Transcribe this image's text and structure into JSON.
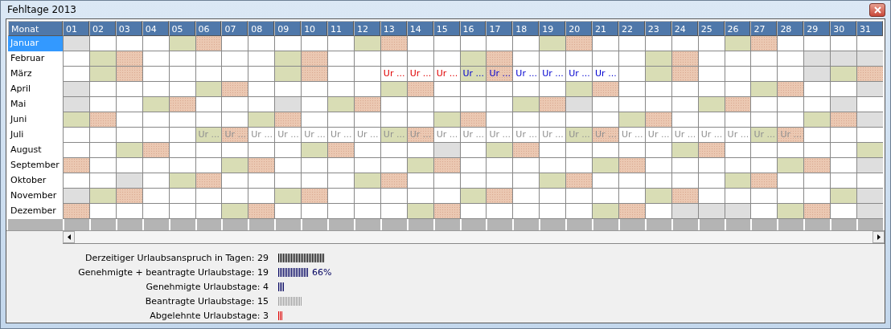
{
  "window": {
    "title": "Fehltage 2013"
  },
  "grid": {
    "corner": "Monat",
    "days": [
      "01",
      "02",
      "03",
      "04",
      "05",
      "06",
      "07",
      "08",
      "09",
      "10",
      "11",
      "12",
      "13",
      "14",
      "15",
      "16",
      "17",
      "18",
      "19",
      "20",
      "21",
      "22",
      "23",
      "24",
      "25",
      "26",
      "27",
      "28",
      "29",
      "30",
      "31"
    ],
    "months": [
      {
        "name": "Januar",
        "selected": true,
        "cells": [
          {
            "kind": "off"
          },
          {
            "kind": "work"
          },
          {
            "kind": "work"
          },
          {
            "kind": "work"
          },
          {
            "kind": "sat"
          },
          {
            "kind": "sun"
          },
          {
            "kind": "work"
          },
          {
            "kind": "work"
          },
          {
            "kind": "work"
          },
          {
            "kind": "work"
          },
          {
            "kind": "work"
          },
          {
            "kind": "sat"
          },
          {
            "kind": "sun"
          },
          {
            "kind": "work"
          },
          {
            "kind": "work"
          },
          {
            "kind": "work"
          },
          {
            "kind": "work"
          },
          {
            "kind": "work"
          },
          {
            "kind": "sat"
          },
          {
            "kind": "sun"
          },
          {
            "kind": "work"
          },
          {
            "kind": "work"
          },
          {
            "kind": "work"
          },
          {
            "kind": "work"
          },
          {
            "kind": "work"
          },
          {
            "kind": "sat"
          },
          {
            "kind": "sun"
          },
          {
            "kind": "work"
          },
          {
            "kind": "work"
          },
          {
            "kind": "work"
          },
          {
            "kind": "work"
          }
        ]
      },
      {
        "name": "Februar",
        "selected": false,
        "cells": [
          {
            "kind": "work"
          },
          {
            "kind": "sat"
          },
          {
            "kind": "sun"
          },
          {
            "kind": "work"
          },
          {
            "kind": "work"
          },
          {
            "kind": "work"
          },
          {
            "kind": "work"
          },
          {
            "kind": "work"
          },
          {
            "kind": "sat"
          },
          {
            "kind": "sun"
          },
          {
            "kind": "work"
          },
          {
            "kind": "work"
          },
          {
            "kind": "work"
          },
          {
            "kind": "work"
          },
          {
            "kind": "work"
          },
          {
            "kind": "sat"
          },
          {
            "kind": "sun"
          },
          {
            "kind": "work"
          },
          {
            "kind": "work"
          },
          {
            "kind": "work"
          },
          {
            "kind": "work"
          },
          {
            "kind": "work"
          },
          {
            "kind": "sat"
          },
          {
            "kind": "sun"
          },
          {
            "kind": "work"
          },
          {
            "kind": "work"
          },
          {
            "kind": "work"
          },
          {
            "kind": "work"
          },
          {
            "kind": "off"
          },
          {
            "kind": "off"
          },
          {
            "kind": "off"
          }
        ]
      },
      {
        "name": "März",
        "selected": false,
        "cells": [
          {
            "kind": "work"
          },
          {
            "kind": "sat"
          },
          {
            "kind": "sun"
          },
          {
            "kind": "work"
          },
          {
            "kind": "work"
          },
          {
            "kind": "work"
          },
          {
            "kind": "work"
          },
          {
            "kind": "work"
          },
          {
            "kind": "sat"
          },
          {
            "kind": "sun"
          },
          {
            "kind": "work"
          },
          {
            "kind": "work"
          },
          {
            "kind": "work",
            "entry": {
              "kind": "rejected",
              "text": "Ur ..."
            }
          },
          {
            "kind": "work",
            "entry": {
              "kind": "rejected",
              "text": "Ur ..."
            }
          },
          {
            "kind": "work",
            "entry": {
              "kind": "rejected",
              "text": "Ur ..."
            }
          },
          {
            "kind": "sat",
            "entry": {
              "kind": "approved",
              "text": "Ur ..."
            }
          },
          {
            "kind": "sun",
            "entry": {
              "kind": "approved",
              "text": "Ur ..."
            }
          },
          {
            "kind": "work",
            "entry": {
              "kind": "approved",
              "text": "Ur ..."
            }
          },
          {
            "kind": "work",
            "entry": {
              "kind": "approved",
              "text": "Ur ..."
            }
          },
          {
            "kind": "work",
            "entry": {
              "kind": "approved",
              "text": "Ur ..."
            }
          },
          {
            "kind": "work",
            "entry": {
              "kind": "approved",
              "text": "Ur ..."
            }
          },
          {
            "kind": "work"
          },
          {
            "kind": "sat"
          },
          {
            "kind": "sun"
          },
          {
            "kind": "work"
          },
          {
            "kind": "work"
          },
          {
            "kind": "work"
          },
          {
            "kind": "work"
          },
          {
            "kind": "off"
          },
          {
            "kind": "sat"
          },
          {
            "kind": "sun"
          }
        ]
      },
      {
        "name": "April",
        "selected": false,
        "cells": [
          {
            "kind": "off"
          },
          {
            "kind": "work"
          },
          {
            "kind": "work"
          },
          {
            "kind": "work"
          },
          {
            "kind": "work"
          },
          {
            "kind": "sat"
          },
          {
            "kind": "sun"
          },
          {
            "kind": "work"
          },
          {
            "kind": "work"
          },
          {
            "kind": "work"
          },
          {
            "kind": "work"
          },
          {
            "kind": "work"
          },
          {
            "kind": "sat"
          },
          {
            "kind": "sun"
          },
          {
            "kind": "work"
          },
          {
            "kind": "work"
          },
          {
            "kind": "work"
          },
          {
            "kind": "work"
          },
          {
            "kind": "work"
          },
          {
            "kind": "sat"
          },
          {
            "kind": "sun"
          },
          {
            "kind": "work"
          },
          {
            "kind": "work"
          },
          {
            "kind": "work"
          },
          {
            "kind": "work"
          },
          {
            "kind": "work"
          },
          {
            "kind": "sat"
          },
          {
            "kind": "sun"
          },
          {
            "kind": "work"
          },
          {
            "kind": "work"
          },
          {
            "kind": "off"
          }
        ]
      },
      {
        "name": "Mai",
        "selected": false,
        "cells": [
          {
            "kind": "off"
          },
          {
            "kind": "work"
          },
          {
            "kind": "work"
          },
          {
            "kind": "sat"
          },
          {
            "kind": "sun"
          },
          {
            "kind": "work"
          },
          {
            "kind": "work"
          },
          {
            "kind": "work"
          },
          {
            "kind": "off"
          },
          {
            "kind": "work"
          },
          {
            "kind": "sat"
          },
          {
            "kind": "sun"
          },
          {
            "kind": "work"
          },
          {
            "kind": "work"
          },
          {
            "kind": "work"
          },
          {
            "kind": "work"
          },
          {
            "kind": "work"
          },
          {
            "kind": "sat"
          },
          {
            "kind": "sun"
          },
          {
            "kind": "off"
          },
          {
            "kind": "work"
          },
          {
            "kind": "work"
          },
          {
            "kind": "work"
          },
          {
            "kind": "work"
          },
          {
            "kind": "sat"
          },
          {
            "kind": "sun"
          },
          {
            "kind": "work"
          },
          {
            "kind": "work"
          },
          {
            "kind": "work"
          },
          {
            "kind": "off"
          },
          {
            "kind": "work"
          }
        ]
      },
      {
        "name": "Juni",
        "selected": false,
        "cells": [
          {
            "kind": "sat"
          },
          {
            "kind": "sun"
          },
          {
            "kind": "work"
          },
          {
            "kind": "work"
          },
          {
            "kind": "work"
          },
          {
            "kind": "work"
          },
          {
            "kind": "work"
          },
          {
            "kind": "sat"
          },
          {
            "kind": "sun"
          },
          {
            "kind": "work"
          },
          {
            "kind": "work"
          },
          {
            "kind": "work"
          },
          {
            "kind": "work"
          },
          {
            "kind": "work"
          },
          {
            "kind": "sat"
          },
          {
            "kind": "sun"
          },
          {
            "kind": "work"
          },
          {
            "kind": "work"
          },
          {
            "kind": "work"
          },
          {
            "kind": "work"
          },
          {
            "kind": "work"
          },
          {
            "kind": "sat"
          },
          {
            "kind": "sun"
          },
          {
            "kind": "work"
          },
          {
            "kind": "work"
          },
          {
            "kind": "work"
          },
          {
            "kind": "work"
          },
          {
            "kind": "work"
          },
          {
            "kind": "sat"
          },
          {
            "kind": "sun"
          },
          {
            "kind": "off"
          }
        ]
      },
      {
        "name": "Juli",
        "selected": false,
        "cells": [
          {
            "kind": "work"
          },
          {
            "kind": "work"
          },
          {
            "kind": "work"
          },
          {
            "kind": "work"
          },
          {
            "kind": "work"
          },
          {
            "kind": "sat",
            "entry": {
              "kind": "requested",
              "text": "Ur ..."
            }
          },
          {
            "kind": "sun",
            "entry": {
              "kind": "requested",
              "text": "Ur ..."
            }
          },
          {
            "kind": "work",
            "entry": {
              "kind": "requested",
              "text": "Ur ..."
            }
          },
          {
            "kind": "work",
            "entry": {
              "kind": "requested",
              "text": "Ur ..."
            }
          },
          {
            "kind": "work",
            "entry": {
              "kind": "requested",
              "text": "Ur ..."
            }
          },
          {
            "kind": "work",
            "entry": {
              "kind": "requested",
              "text": "Ur ..."
            }
          },
          {
            "kind": "work",
            "entry": {
              "kind": "requested",
              "text": "Ur ..."
            }
          },
          {
            "kind": "sat",
            "entry": {
              "kind": "requested",
              "text": "Ur ..."
            }
          },
          {
            "kind": "sun",
            "entry": {
              "kind": "requested",
              "text": "Ur ..."
            }
          },
          {
            "kind": "work",
            "entry": {
              "kind": "requested",
              "text": "Ur ..."
            }
          },
          {
            "kind": "work",
            "entry": {
              "kind": "requested",
              "text": "Ur ..."
            }
          },
          {
            "kind": "work",
            "entry": {
              "kind": "requested",
              "text": "Ur ..."
            }
          },
          {
            "kind": "work",
            "entry": {
              "kind": "requested",
              "text": "Ur ..."
            }
          },
          {
            "kind": "work",
            "entry": {
              "kind": "requested",
              "text": "Ur ..."
            }
          },
          {
            "kind": "sat",
            "entry": {
              "kind": "requested",
              "text": "Ur ..."
            }
          },
          {
            "kind": "sun",
            "entry": {
              "kind": "requested",
              "text": "Ur ..."
            }
          },
          {
            "kind": "work",
            "entry": {
              "kind": "requested",
              "text": "Ur ..."
            }
          },
          {
            "kind": "work",
            "entry": {
              "kind": "requested",
              "text": "Ur ..."
            }
          },
          {
            "kind": "work",
            "entry": {
              "kind": "requested",
              "text": "Ur ..."
            }
          },
          {
            "kind": "work",
            "entry": {
              "kind": "requested",
              "text": "Ur ..."
            }
          },
          {
            "kind": "work",
            "entry": {
              "kind": "requested",
              "text": "Ur ..."
            }
          },
          {
            "kind": "sat",
            "entry": {
              "kind": "requested",
              "text": "Ur ..."
            }
          },
          {
            "kind": "sun",
            "entry": {
              "kind": "requested",
              "text": "Ur ..."
            }
          },
          {
            "kind": "work"
          },
          {
            "kind": "work"
          },
          {
            "kind": "work"
          }
        ]
      },
      {
        "name": "August",
        "selected": false,
        "cells": [
          {
            "kind": "work"
          },
          {
            "kind": "work"
          },
          {
            "kind": "sat"
          },
          {
            "kind": "sun"
          },
          {
            "kind": "work"
          },
          {
            "kind": "work"
          },
          {
            "kind": "work"
          },
          {
            "kind": "work"
          },
          {
            "kind": "work"
          },
          {
            "kind": "sat"
          },
          {
            "kind": "sun"
          },
          {
            "kind": "work"
          },
          {
            "kind": "work"
          },
          {
            "kind": "work"
          },
          {
            "kind": "off"
          },
          {
            "kind": "work"
          },
          {
            "kind": "sat"
          },
          {
            "kind": "sun"
          },
          {
            "kind": "work"
          },
          {
            "kind": "work"
          },
          {
            "kind": "work"
          },
          {
            "kind": "work"
          },
          {
            "kind": "work"
          },
          {
            "kind": "sat"
          },
          {
            "kind": "sun"
          },
          {
            "kind": "work"
          },
          {
            "kind": "work"
          },
          {
            "kind": "work"
          },
          {
            "kind": "work"
          },
          {
            "kind": "work"
          },
          {
            "kind": "sat"
          }
        ]
      },
      {
        "name": "September",
        "selected": false,
        "cells": [
          {
            "kind": "sun"
          },
          {
            "kind": "work"
          },
          {
            "kind": "work"
          },
          {
            "kind": "work"
          },
          {
            "kind": "work"
          },
          {
            "kind": "work"
          },
          {
            "kind": "sat"
          },
          {
            "kind": "sun"
          },
          {
            "kind": "work"
          },
          {
            "kind": "work"
          },
          {
            "kind": "work"
          },
          {
            "kind": "work"
          },
          {
            "kind": "work"
          },
          {
            "kind": "sat"
          },
          {
            "kind": "sun"
          },
          {
            "kind": "work"
          },
          {
            "kind": "work"
          },
          {
            "kind": "work"
          },
          {
            "kind": "work"
          },
          {
            "kind": "work"
          },
          {
            "kind": "sat"
          },
          {
            "kind": "sun"
          },
          {
            "kind": "work"
          },
          {
            "kind": "work"
          },
          {
            "kind": "work"
          },
          {
            "kind": "work"
          },
          {
            "kind": "work"
          },
          {
            "kind": "sat"
          },
          {
            "kind": "sun"
          },
          {
            "kind": "work"
          },
          {
            "kind": "off"
          }
        ]
      },
      {
        "name": "Oktober",
        "selected": false,
        "cells": [
          {
            "kind": "work"
          },
          {
            "kind": "work"
          },
          {
            "kind": "off"
          },
          {
            "kind": "work"
          },
          {
            "kind": "sat"
          },
          {
            "kind": "sun"
          },
          {
            "kind": "work"
          },
          {
            "kind": "work"
          },
          {
            "kind": "work"
          },
          {
            "kind": "work"
          },
          {
            "kind": "work"
          },
          {
            "kind": "sat"
          },
          {
            "kind": "sun"
          },
          {
            "kind": "work"
          },
          {
            "kind": "work"
          },
          {
            "kind": "work"
          },
          {
            "kind": "work"
          },
          {
            "kind": "work"
          },
          {
            "kind": "sat"
          },
          {
            "kind": "sun"
          },
          {
            "kind": "work"
          },
          {
            "kind": "work"
          },
          {
            "kind": "work"
          },
          {
            "kind": "work"
          },
          {
            "kind": "work"
          },
          {
            "kind": "sat"
          },
          {
            "kind": "sun"
          },
          {
            "kind": "work"
          },
          {
            "kind": "work"
          },
          {
            "kind": "work"
          },
          {
            "kind": "work"
          }
        ]
      },
      {
        "name": "November",
        "selected": false,
        "cells": [
          {
            "kind": "off"
          },
          {
            "kind": "sat"
          },
          {
            "kind": "sun"
          },
          {
            "kind": "work"
          },
          {
            "kind": "work"
          },
          {
            "kind": "work"
          },
          {
            "kind": "work"
          },
          {
            "kind": "work"
          },
          {
            "kind": "sat"
          },
          {
            "kind": "sun"
          },
          {
            "kind": "work"
          },
          {
            "kind": "work"
          },
          {
            "kind": "work"
          },
          {
            "kind": "work"
          },
          {
            "kind": "work"
          },
          {
            "kind": "sat"
          },
          {
            "kind": "sun"
          },
          {
            "kind": "work"
          },
          {
            "kind": "work"
          },
          {
            "kind": "work"
          },
          {
            "kind": "work"
          },
          {
            "kind": "work"
          },
          {
            "kind": "sat"
          },
          {
            "kind": "sun"
          },
          {
            "kind": "work"
          },
          {
            "kind": "work"
          },
          {
            "kind": "work"
          },
          {
            "kind": "work"
          },
          {
            "kind": "work"
          },
          {
            "kind": "sat"
          },
          {
            "kind": "off"
          }
        ]
      },
      {
        "name": "Dezember",
        "selected": false,
        "cells": [
          {
            "kind": "sun"
          },
          {
            "kind": "work"
          },
          {
            "kind": "work"
          },
          {
            "kind": "work"
          },
          {
            "kind": "work"
          },
          {
            "kind": "work"
          },
          {
            "kind": "sat"
          },
          {
            "kind": "sun"
          },
          {
            "kind": "work"
          },
          {
            "kind": "work"
          },
          {
            "kind": "work"
          },
          {
            "kind": "work"
          },
          {
            "kind": "work"
          },
          {
            "kind": "sat"
          },
          {
            "kind": "sun"
          },
          {
            "kind": "work"
          },
          {
            "kind": "work"
          },
          {
            "kind": "work"
          },
          {
            "kind": "work"
          },
          {
            "kind": "work"
          },
          {
            "kind": "sat"
          },
          {
            "kind": "sun"
          },
          {
            "kind": "work"
          },
          {
            "kind": "off"
          },
          {
            "kind": "off"
          },
          {
            "kind": "off"
          },
          {
            "kind": "work"
          },
          {
            "kind": "sat"
          },
          {
            "kind": "sun"
          },
          {
            "kind": "work"
          },
          {
            "kind": "off"
          }
        ]
      }
    ]
  },
  "stats": [
    {
      "label": "Derzeitiger Urlaubsanspruch in Tagen: 29",
      "color": "#000000"
    },
    {
      "label": "Genehmigte + beantragte Urlaubstage: 19",
      "color": "#000060",
      "percent": "66%"
    },
    {
      "label": "Genehmigte Urlaubstage: 4",
      "color": "#000060"
    },
    {
      "label": "Beantragte Urlaubstage: 15",
      "color": "#a0a0a0"
    },
    {
      "label": "Abgelehnte Urlaubstage: 3",
      "color": "#e00000"
    }
  ]
}
